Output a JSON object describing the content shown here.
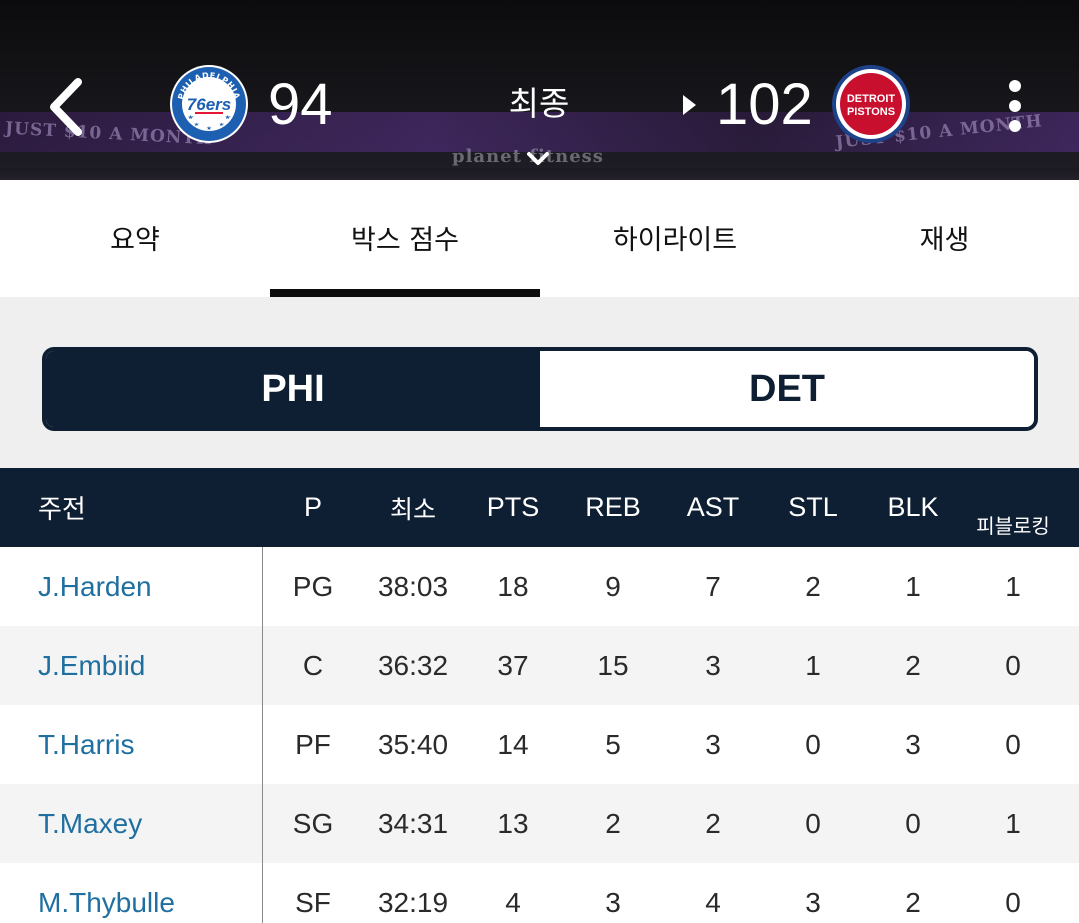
{
  "header": {
    "home": {
      "abbr": "PHI",
      "score": "94",
      "logo_text": "76ers",
      "logo_ring_text": "PHILADELPHIA"
    },
    "away": {
      "abbr": "DET",
      "score": "102",
      "logo_text_top": "DETROIT",
      "logo_text_bottom": "PISTONS"
    },
    "status": "최종",
    "ads": [
      "JUST $10 A MONTH",
      "planet fitness",
      "JUST $10 A MONTH"
    ],
    "icons": {
      "back": "back-chevron-icon",
      "expand": "chevron-down-icon",
      "more": "more-vertical-icon",
      "winner": "winner-arrow-icon"
    }
  },
  "tabs": [
    {
      "label": "요약",
      "active": false
    },
    {
      "label": "박스 점수",
      "active": true
    },
    {
      "label": "하이라이트",
      "active": false
    },
    {
      "label": "재생",
      "active": false
    }
  ],
  "team_toggle": {
    "home_label": "PHI",
    "away_label": "DET",
    "selected": "PHI"
  },
  "table": {
    "section_label": "주전",
    "columns": [
      "P",
      "최소",
      "PTS",
      "REB",
      "AST",
      "STL",
      "BLK",
      "피블로킹"
    ],
    "rows": [
      {
        "name": "J.Harden",
        "pos": "PG",
        "min": "38:03",
        "pts": "18",
        "reb": "9",
        "ast": "7",
        "stl": "2",
        "blk": "1",
        "pf": "1"
      },
      {
        "name": "J.Embiid",
        "pos": "C",
        "min": "36:32",
        "pts": "37",
        "reb": "15",
        "ast": "3",
        "stl": "1",
        "blk": "2",
        "pf": "0"
      },
      {
        "name": "T.Harris",
        "pos": "PF",
        "min": "35:40",
        "pts": "14",
        "reb": "5",
        "ast": "3",
        "stl": "0",
        "blk": "3",
        "pf": "0"
      },
      {
        "name": "T.Maxey",
        "pos": "SG",
        "min": "34:31",
        "pts": "13",
        "reb": "2",
        "ast": "2",
        "stl": "0",
        "blk": "0",
        "pf": "1"
      },
      {
        "name": "M.Thybulle",
        "pos": "SF",
        "min": "32:19",
        "pts": "4",
        "reb": "3",
        "ast": "4",
        "stl": "3",
        "blk": "2",
        "pf": "0"
      }
    ]
  },
  "colors": {
    "navy": "#0e1f33",
    "player_link": "#1f6fa0",
    "sixers_blue": "#1d5fb0",
    "sixers_red": "#e31837",
    "pistons_red": "#c8102e",
    "pistons_blue": "#1d428a"
  }
}
